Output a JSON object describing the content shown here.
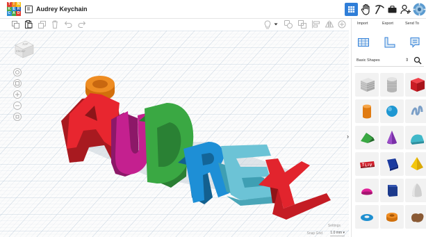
{
  "app": {
    "logo_letters": [
      "T",
      "I",
      "N",
      "K",
      "E",
      "R",
      "C",
      "A",
      "D"
    ],
    "title": "Audrey Keychain"
  },
  "header_right": {
    "icons": [
      "grid-view-icon",
      "hand-icon",
      "pick-icon",
      "briefcase-icon",
      "add-user-icon",
      "avatar-icon"
    ]
  },
  "toolbar": {
    "icons": [
      "copy-icon",
      "paste-icon",
      "duplicate-icon",
      "delete-icon",
      "undo-icon",
      "redo-icon"
    ],
    "right_icons": [
      "light-bulb-icon",
      "shape-outline-icon",
      "group-icon",
      "align-icon",
      "mirror-icon",
      "workplane-icon"
    ]
  },
  "viewport": {
    "viewcube_top": "TOP",
    "viewcube_front": "FRONT",
    "letters": [
      "A",
      "U",
      "D",
      "R",
      "E",
      "Y"
    ],
    "letter_colors": [
      "#e8262f",
      "#c4208f",
      "#3aa843",
      "#1e8fd6",
      "#6cc3d6",
      "#e2242d"
    ],
    "ring_color": "#ea8a1e",
    "settings_label": "Settings",
    "snap_grid_label": "Snap Grid",
    "snap_grid_value": "1.0 mm"
  },
  "panel": {
    "tabs": [
      "Import",
      "Export",
      "Send To"
    ],
    "view_icons": [
      "workplane-grid-icon",
      "ruler-icon",
      "notes-icon"
    ],
    "category": "Basic Shapes",
    "shapes": [
      {
        "name": "box-hole",
        "color": "#bdbdbd"
      },
      {
        "name": "cylinder-hole",
        "color": "#bdbdbd"
      },
      {
        "name": "box",
        "color": "#e0262d"
      },
      {
        "name": "cylinder",
        "color": "#f28c19"
      },
      {
        "name": "sphere",
        "color": "#1e97d2"
      },
      {
        "name": "scribble",
        "color": "#7b9fc7"
      },
      {
        "name": "roof",
        "color": "#3aa843"
      },
      {
        "name": "cone",
        "color": "#7a2fa8"
      },
      {
        "name": "round-roof",
        "color": "#40b8c9"
      },
      {
        "name": "text",
        "color": "#d01f2b"
      },
      {
        "name": "shape-generators",
        "color": "#1c3ba0"
      },
      {
        "name": "pyramid",
        "color": "#f3c60c"
      },
      {
        "name": "half-sphere",
        "color": "#e02098"
      },
      {
        "name": "polygon",
        "color": "#1c3a8c"
      },
      {
        "name": "paraboloid",
        "color": "#cfcfcf"
      },
      {
        "name": "torus",
        "color": "#1e8fd0"
      },
      {
        "name": "tube",
        "color": "#ea8a1e"
      },
      {
        "name": "organic",
        "color": "#8a5a35"
      }
    ]
  }
}
